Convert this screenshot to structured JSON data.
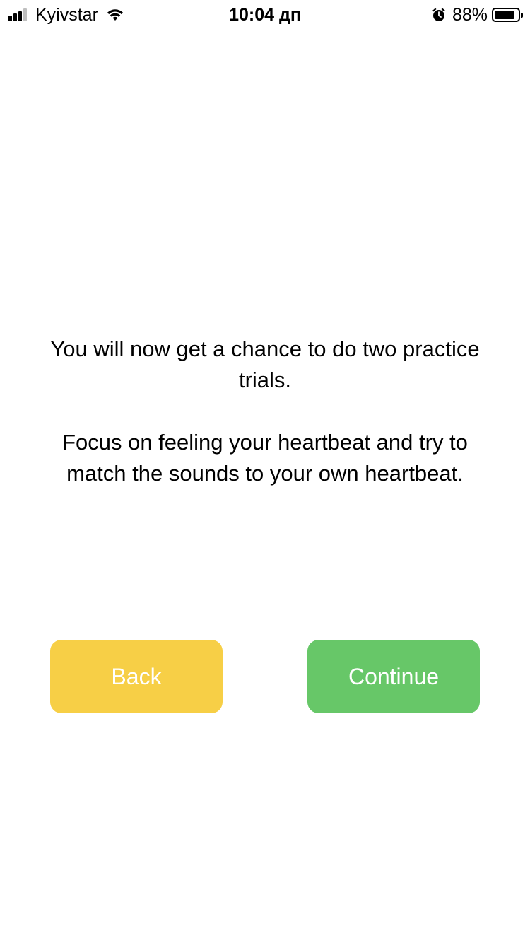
{
  "status_bar": {
    "carrier": "Kyivstar",
    "signal_bars": 3,
    "wifi_icon": "wifi-icon",
    "time": "10:04 дп",
    "alarm_icon": "alarm-clock-icon",
    "battery_percent_label": "88%",
    "battery_level": 0.88
  },
  "instructions": {
    "paragraph_1": "You will now get a chance to do two practice trials.",
    "paragraph_2": "Focus on feeling your heartbeat and try to match the sounds to your own heartbeat."
  },
  "buttons": {
    "back_label": "Back",
    "continue_label": "Continue"
  },
  "colors": {
    "back_button": "#F7CF46",
    "continue_button": "#67C768",
    "button_text": "#FFFFFF",
    "background": "#FFFFFF"
  }
}
